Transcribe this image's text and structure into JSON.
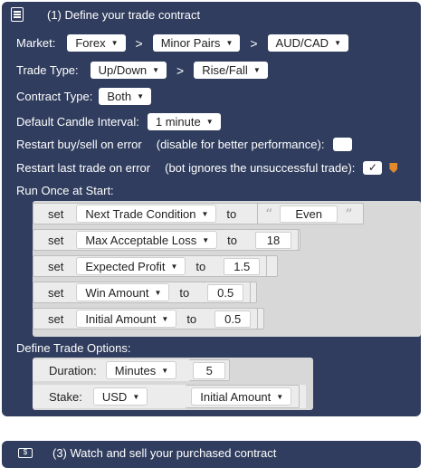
{
  "header": {
    "title": "(1) Define your trade contract",
    "icon": "list-icon"
  },
  "market": {
    "label": "Market:",
    "values": [
      "Forex",
      "Minor Pairs",
      "AUD/CAD"
    ],
    "separator": ">"
  },
  "trade_type": {
    "label": "Trade Type:",
    "values": [
      "Up/Down",
      "Rise/Fall"
    ],
    "separator": ">"
  },
  "contract_type": {
    "label": "Contract Type:",
    "value": "Both"
  },
  "candle": {
    "label": "Default Candle Interval:",
    "value": "1 minute"
  },
  "restart_error": {
    "label": "Restart buy/sell on error",
    "note": "(disable for better performance):",
    "checked": false
  },
  "restart_last": {
    "label": "Restart last trade on error",
    "note": "(bot ignores the unsuccessful trade):",
    "checked": true,
    "check_glyph": "✓"
  },
  "run_once": {
    "label": "Run Once at Start:",
    "statements": [
      {
        "kw": "set",
        "var": "Next Trade Condition",
        "to": "to",
        "value": "Even",
        "quoted": true
      },
      {
        "kw": "set",
        "var": "Max Acceptable Loss",
        "to": "to",
        "value": "18"
      },
      {
        "kw": "set",
        "var": "Expected Profit",
        "to": "to",
        "value": "1.5"
      },
      {
        "kw": "set",
        "var": "Win Amount",
        "to": "to",
        "value": "0.5"
      },
      {
        "kw": "set",
        "var": "Initial Amount",
        "to": "to",
        "value": "0.5"
      }
    ]
  },
  "trade_options": {
    "label": "Define Trade Options:",
    "duration_label": "Duration:",
    "duration_unit": "Minutes",
    "duration_value": "5",
    "stake_label": "Stake:",
    "currency": "USD",
    "stake_var": "Initial Amount"
  },
  "watch": {
    "title": "(3) Watch and sell your purchased contract",
    "icon": "dollar-icon",
    "glyph": "$"
  },
  "colors": {
    "block_bg": "#303d5e",
    "warn": "#e08a2b"
  }
}
